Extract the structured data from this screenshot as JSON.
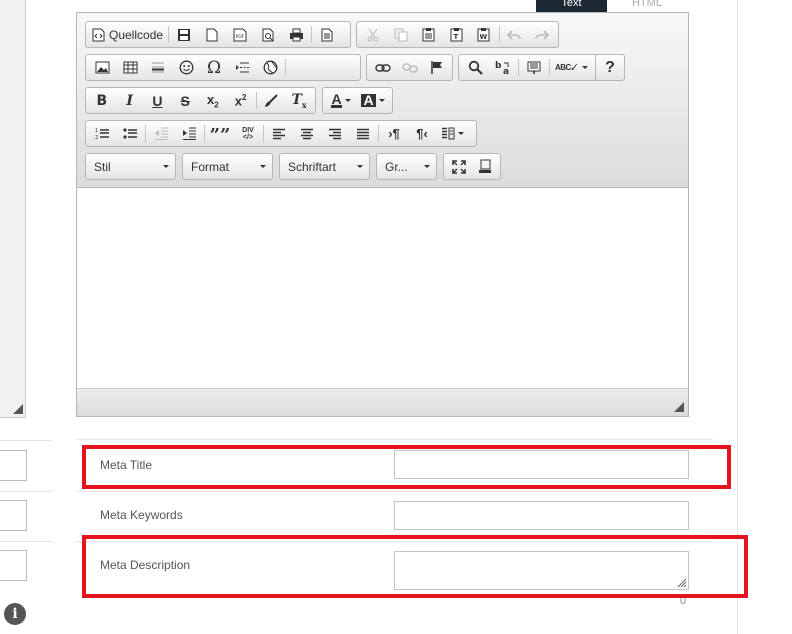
{
  "tabs": {
    "active": "Text",
    "inactive": "HTML"
  },
  "toolbar": {
    "source_label": "Quellcode",
    "styles_combo": "Stil",
    "format_combo": "Format",
    "font_combo": "Schriftart",
    "size_combo": "Gr...",
    "spellcheck_label": "ABC",
    "help_label": "?",
    "blockquote_label": "””",
    "div_label": "DIV"
  },
  "meta": {
    "title_label": "Meta Title",
    "title_value": "",
    "keywords_label": "Meta Keywords",
    "keywords_value": "",
    "description_label": "Meta Description",
    "description_value": "",
    "description_counter": "0"
  },
  "colors": {
    "highlight": "#e3141b",
    "active_tab": "#1c2833"
  }
}
